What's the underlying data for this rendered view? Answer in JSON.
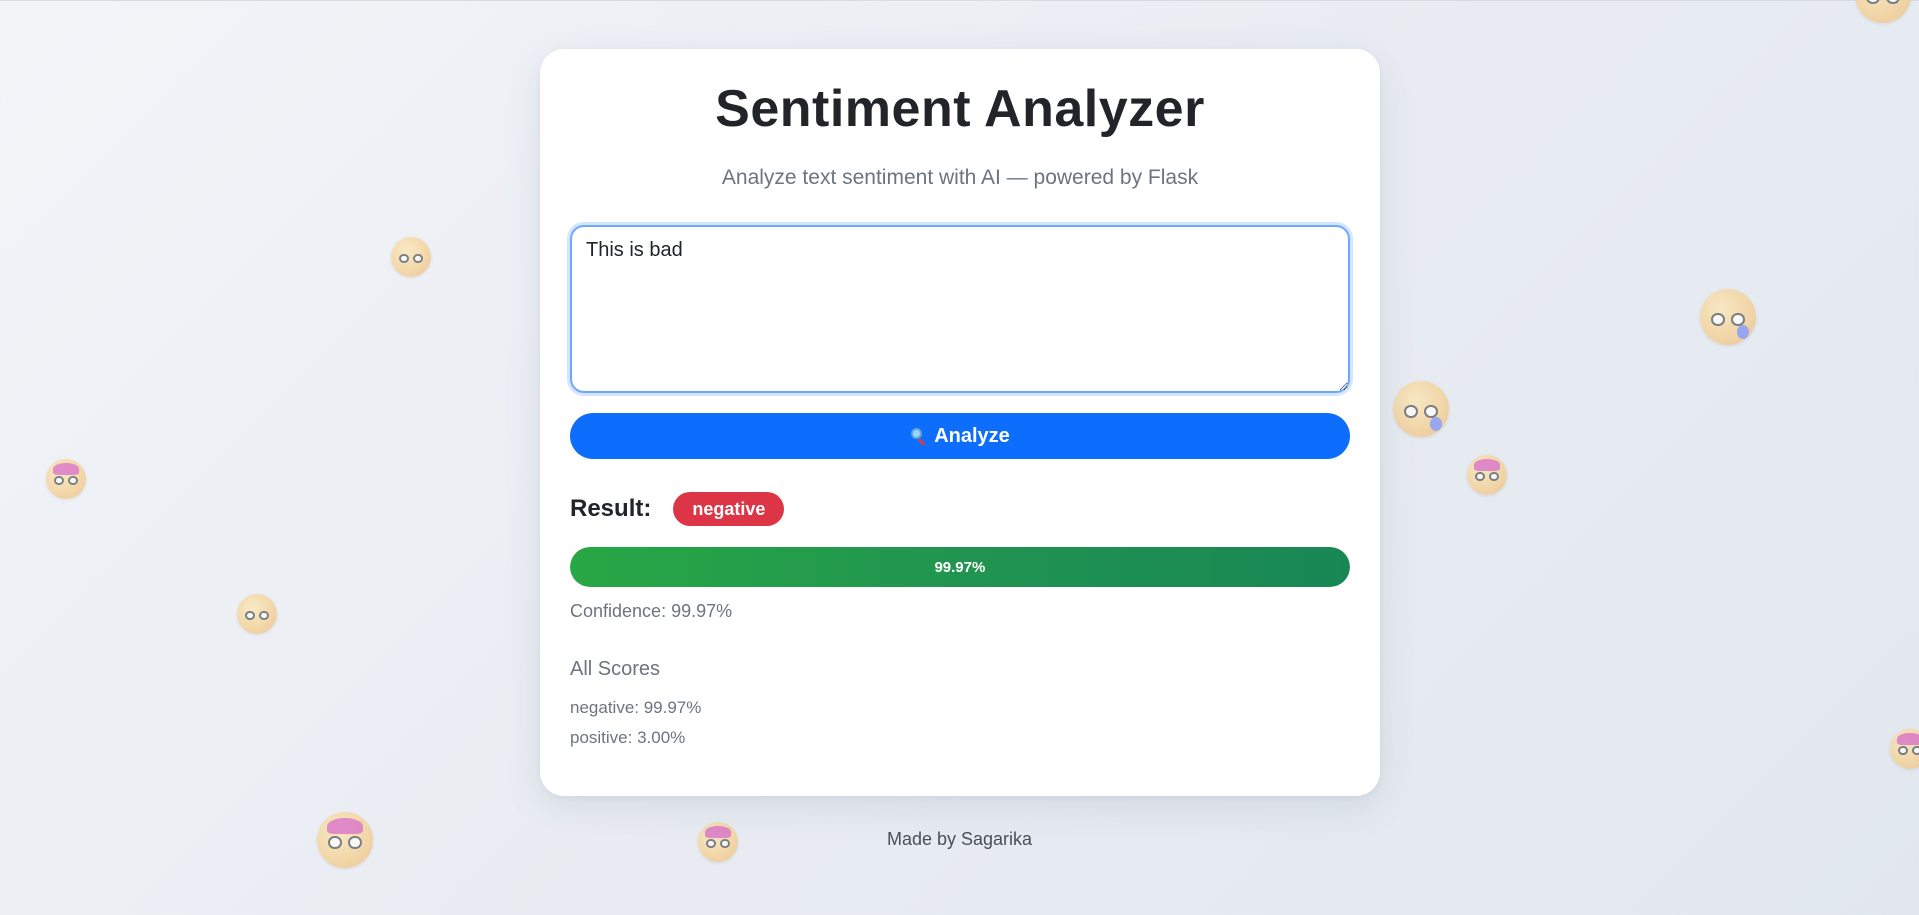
{
  "app": {
    "title": "Sentiment Analyzer",
    "subtitle": "Analyze text sentiment with AI — powered by Flask"
  },
  "input": {
    "value": "This is bad",
    "placeholder": ""
  },
  "analyze_button": {
    "label": "Analyze",
    "icon": "magnifying-glass-icon"
  },
  "result": {
    "label": "Result:",
    "sentiment": "negative",
    "badge_color": "#dc3545",
    "confidence_value": 99.97,
    "confidence_bar_text": "99.97%",
    "confidence_text": "Confidence: 99.97%"
  },
  "scores": {
    "title": "All Scores",
    "items": [
      {
        "text": "negative: 99.97%"
      },
      {
        "text": "positive: 3.00%"
      }
    ]
  },
  "footer": {
    "text": "Made by Sagarika"
  },
  "colors": {
    "accent": "#0d6efd",
    "success": "#198754",
    "danger": "#dc3545",
    "muted": "#6c757d"
  }
}
